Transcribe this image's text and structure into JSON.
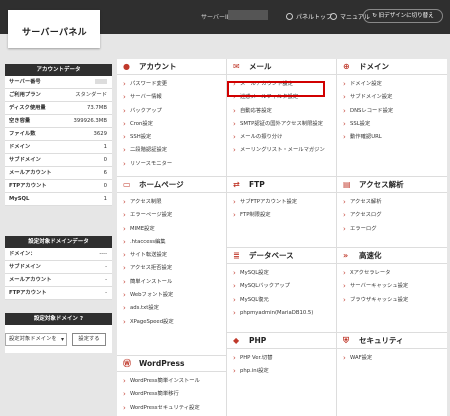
{
  "header": {
    "logo": "サーバーパネル",
    "server_id_label": "サーバーID",
    "panel_top": "パネルトップ",
    "manual": "マニュアル",
    "old_design_button": "旧デザインに切り替え"
  },
  "account_data": {
    "title": "アカウントデータ",
    "rows": [
      {
        "label": "サーバー番号",
        "value": ""
      },
      {
        "label": "ご利用プラン",
        "value": "スタンダード"
      },
      {
        "label": "ディスク使用量",
        "value": "73.7MB"
      },
      {
        "label": "空き容量",
        "value": "399926.3MB"
      },
      {
        "label": "ファイル数",
        "value": "3629"
      },
      {
        "label": "ドメイン",
        "value": "1"
      },
      {
        "label": "サブドメイン",
        "value": "0"
      },
      {
        "label": "メールアカウント",
        "value": "6"
      },
      {
        "label": "FTPアカウント",
        "value": "0"
      },
      {
        "label": "MySQL",
        "value": "1"
      }
    ]
  },
  "target_domain_data": {
    "title": "設定対象ドメインデータ",
    "rows": [
      {
        "label": "ドメイン：",
        "value": "----"
      },
      {
        "label": "サブドメイン",
        "value": "-"
      },
      {
        "label": "メールアカウント",
        "value": "-"
      },
      {
        "label": "FTPアカウント",
        "value": "-"
      }
    ]
  },
  "target_domain": {
    "title": "設定対象ドメイン",
    "select_value": "設定対象ドメインを",
    "set_button": "設定する"
  },
  "sections": {
    "account": {
      "title": "アカウント",
      "items": [
        "パスワード変更",
        "サーバー情報",
        "バックアップ",
        "Cron設定",
        "SSH設定",
        "二段階認証設定",
        "リソースモニター"
      ]
    },
    "mail": {
      "title": "メール",
      "items": [
        "メールアカウント設定",
        "迷惑メールフィルタ設定",
        "自動応答設定",
        "SMTP認証の国外アクセス制限設定",
        "メールの振り分け",
        "メーリングリスト・メールマガジン"
      ]
    },
    "domain": {
      "title": "ドメイン",
      "items": [
        "ドメイン設定",
        "サブドメイン設定",
        "DNSレコード設定",
        "SSL設定",
        "動作確認URL"
      ]
    },
    "homepage": {
      "title": "ホームページ",
      "items": [
        "アクセス制限",
        "エラーページ設定",
        "MIME設定",
        ".htaccess編集",
        "サイト転送設定",
        "アクセス拒否設定",
        "簡単インストール",
        "Webフォント設定",
        "ads.txt設定",
        "XPageSpeed設定"
      ]
    },
    "ftp": {
      "title": "FTP",
      "items": [
        "サブFTPアカウント設定",
        "FTP制限設定"
      ]
    },
    "access": {
      "title": "アクセス解析",
      "items": [
        "アクセス解析",
        "アクセスログ",
        "エラーログ"
      ]
    },
    "database": {
      "title": "データベース",
      "items": [
        "MySQL設定",
        "MySQLバックアップ",
        "MySQL復元",
        "phpmyadmin(MariaDB10.5)"
      ]
    },
    "speed": {
      "title": "高速化",
      "items": [
        "Xアクセラレータ",
        "サーバーキャッシュ設定",
        "ブラウザキャッシュ設定"
      ]
    },
    "wordpress": {
      "title": "WordPress",
      "items": [
        "WordPress簡単インストール",
        "WordPress簡単移行",
        "WordPressセキュリティ設定"
      ]
    },
    "php": {
      "title": "PHP",
      "items": [
        "PHP Ver.切替",
        "php.ini設定"
      ]
    },
    "security": {
      "title": "セキュリティ",
      "items": [
        "WAF設定"
      ]
    }
  },
  "icons": {
    "accent": "#c0392b",
    "highlight": "#d10000"
  }
}
